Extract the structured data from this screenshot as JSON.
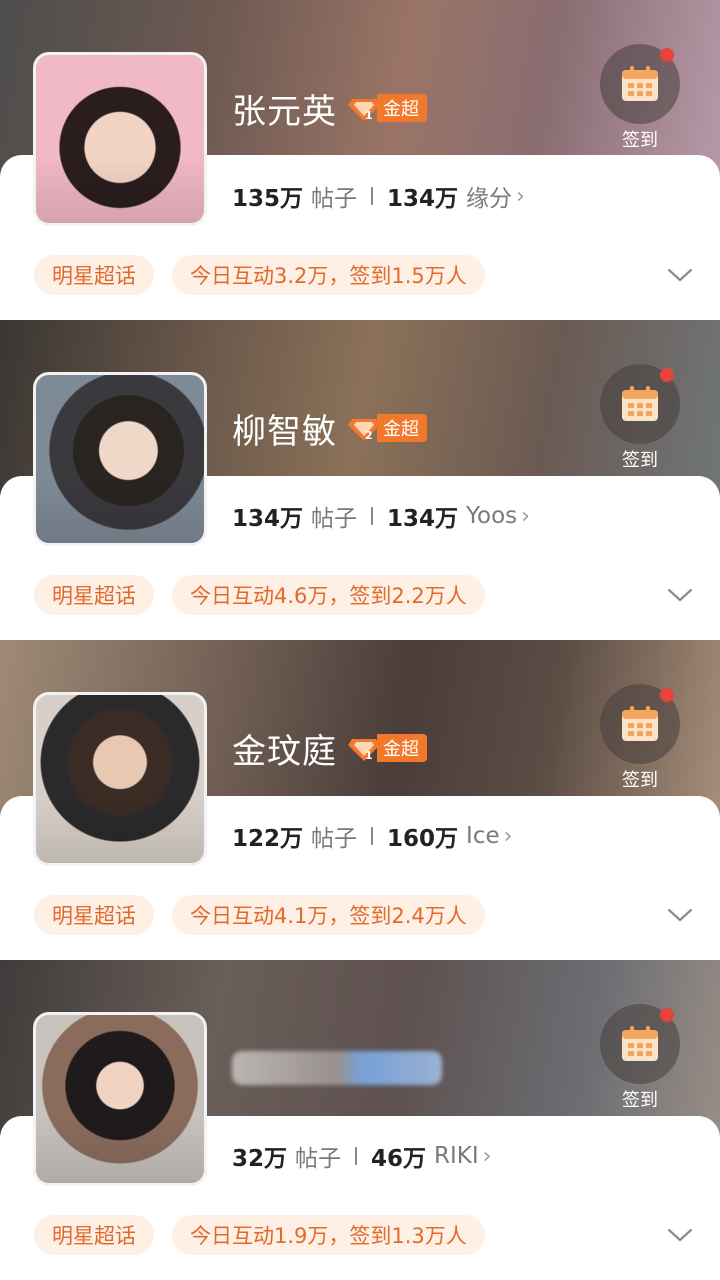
{
  "colors": {
    "accent_orange": "#f2792b",
    "tag_bg": "#fef0e5",
    "tag_text": "#e06b2c",
    "notify_red": "#e8423a"
  },
  "cards": [
    {
      "name": "张元英",
      "badge_level": "1",
      "badge_label": "金超",
      "checkin_label": "签到",
      "posts_value": "135万",
      "posts_unit": "帖子",
      "fans_value": "134万",
      "fans_unit": "缘分",
      "tag_type": "明星超话",
      "tag_activity": "今日互动3.2万，签到1.5万人"
    },
    {
      "name": "柳智敏",
      "badge_level": "2",
      "badge_label": "金超",
      "checkin_label": "签到",
      "posts_value": "134万",
      "posts_unit": "帖子",
      "fans_value": "134万",
      "fans_unit": "Yoos",
      "tag_type": "明星超话",
      "tag_activity": "今日互动4.6万，签到2.2万人"
    },
    {
      "name": "金玟庭",
      "badge_level": "1",
      "badge_label": "金超",
      "checkin_label": "签到",
      "posts_value": "122万",
      "posts_unit": "帖子",
      "fans_value": "160万",
      "fans_unit": "Ice",
      "tag_type": "明星超话",
      "tag_activity": "今日互动4.1万，签到2.4万人"
    },
    {
      "name": "",
      "badge_level": "",
      "badge_label": "",
      "checkin_label": "签到",
      "posts_value": "32万",
      "posts_unit": "帖子",
      "fans_value": "46万",
      "fans_unit": "RIKI",
      "tag_type": "明星超话",
      "tag_activity": "今日互动1.9万，签到1.3万人"
    }
  ]
}
